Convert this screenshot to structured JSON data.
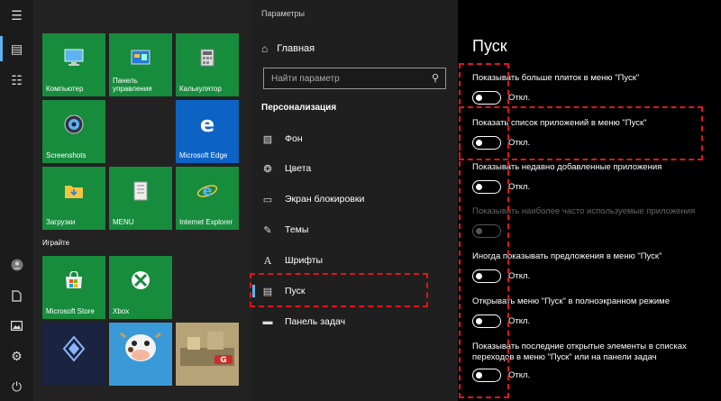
{
  "rail": {
    "icons": [
      "hamburger-icon",
      "tiles-icon",
      "list-icon",
      "user-icon",
      "document-icon",
      "pictures-icon",
      "gear-icon",
      "power-icon"
    ]
  },
  "tiles": {
    "items": [
      {
        "label": "Компьютер",
        "icon": "computer-icon"
      },
      {
        "label": "Панель управления",
        "icon": "control-panel-icon"
      },
      {
        "label": "Калькулятор",
        "icon": "calculator-icon"
      },
      {
        "label": "Screenshots",
        "icon": "aperture-icon"
      },
      {
        "label": "Microsoft Edge",
        "icon": "edge-icon"
      },
      {
        "label": "Загрузки",
        "icon": "folder-download-icon"
      },
      {
        "label": "MENU",
        "icon": "menu-app-icon"
      },
      {
        "label": "Internet Explorer",
        "icon": "ie-icon"
      },
      {
        "label": "Microsoft Store",
        "icon": "store-icon"
      },
      {
        "label": "Xbox",
        "icon": "xbox-icon"
      }
    ],
    "group_label": "Играйте",
    "colors": {
      "green": "#178c3d",
      "blue": "#0d63c4"
    }
  },
  "settings": {
    "window_title": "Параметры",
    "home": "Главная",
    "search_placeholder": "Найти параметр",
    "section": "Персонализация",
    "nav": [
      {
        "label": "Фон",
        "icon": "picture-icon"
      },
      {
        "label": "Цвета",
        "icon": "palette-icon"
      },
      {
        "label": "Экран блокировки",
        "icon": "lock-screen-icon"
      },
      {
        "label": "Темы",
        "icon": "themes-icon"
      },
      {
        "label": "Шрифты",
        "icon": "fonts-icon"
      },
      {
        "label": "Пуск",
        "icon": "start-icon"
      },
      {
        "label": "Панель задач",
        "icon": "taskbar-icon"
      }
    ],
    "page_title": "Пуск",
    "options": [
      {
        "label": "Показывать больше плиток в меню \"Пуск\"",
        "state": "Откл."
      },
      {
        "label": "Показать список приложений в меню \"Пуск\"",
        "state": "Откл."
      },
      {
        "label": "Показывать недавно добавленные приложения",
        "state": "Откл."
      },
      {
        "label": "Показывать наиболее часто используемые приложения",
        "state": ""
      },
      {
        "label": "Иногда показывать предложения в меню \"Пуск\"",
        "state": "Откл."
      },
      {
        "label": "Открывать меню \"Пуск\" в полноэкранном режиме",
        "state": "Откл."
      },
      {
        "label": "Показывать последние открытые элементы в списках",
        "label2": "переходов в меню \"Пуск\" или на панели задач",
        "state": "Откл."
      }
    ],
    "accent": "#5fb2f0",
    "annotation_color": "#e0161b"
  }
}
